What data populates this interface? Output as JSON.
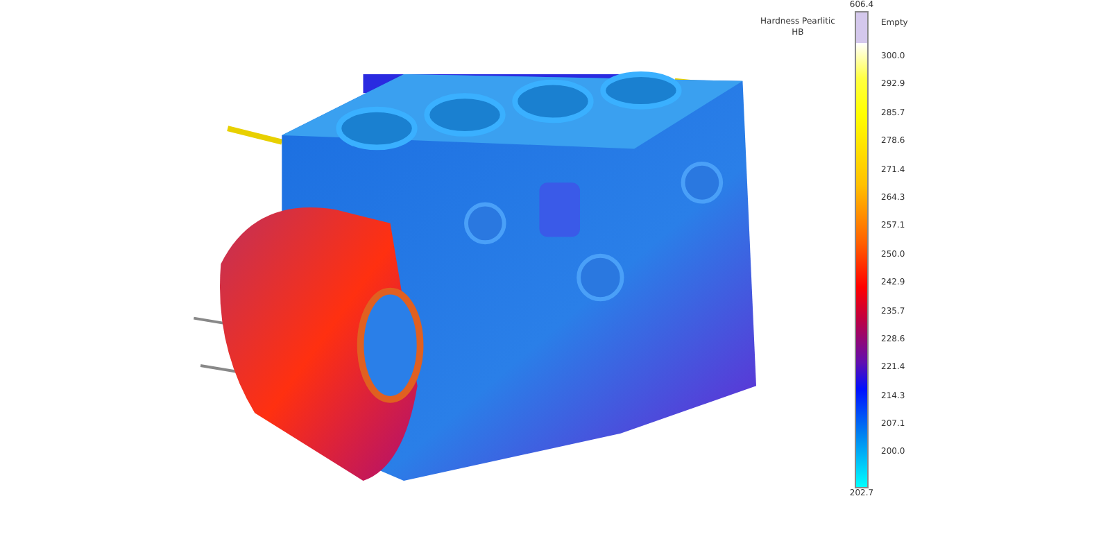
{
  "legend": {
    "title": "Hardness Pearlitic HB",
    "max_label": "606.4",
    "min_label": "202.7",
    "empty_label": "Empty",
    "ticks": [
      "300.0",
      "292.9",
      "285.7",
      "278.6",
      "271.4",
      "264.3",
      "257.1",
      "250.0",
      "242.9",
      "235.7",
      "228.6",
      "221.4",
      "214.3",
      "207.1",
      "200.0"
    ]
  }
}
